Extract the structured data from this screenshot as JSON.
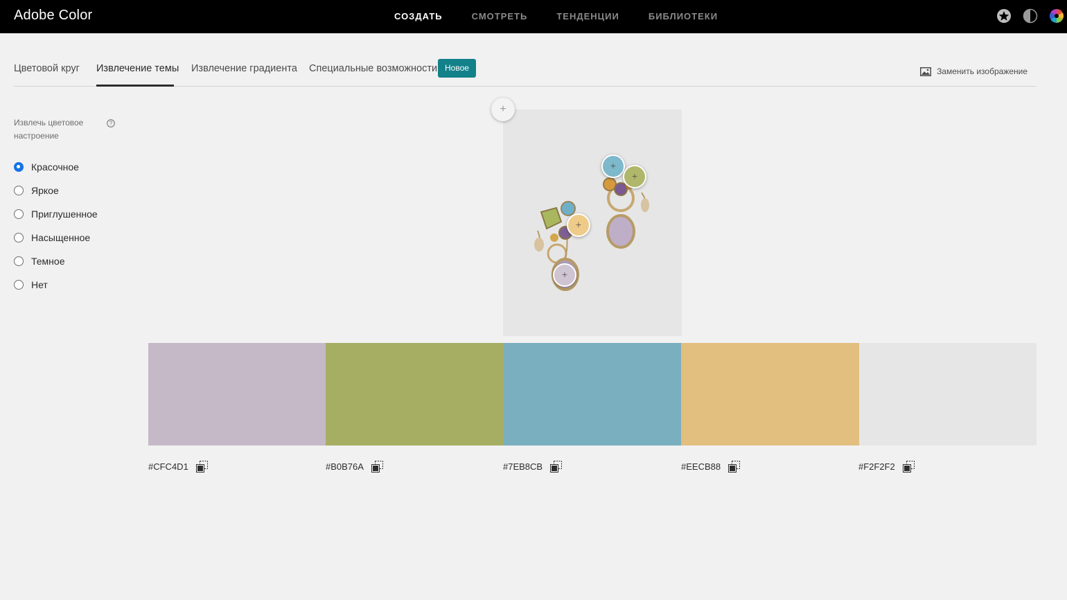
{
  "topbar": {
    "brand": "Adobe Color",
    "nav": [
      "СОЗДАТЬ",
      "СМОТРЕТЬ",
      "ТЕНДЕНЦИИ",
      "БИБЛИОТЕКИ"
    ],
    "active_nav": "СОЗДАТЬ",
    "icons": [
      "star-icon",
      "contrast-icon",
      "color-wheel-icon"
    ]
  },
  "tabs": {
    "items": [
      "Цветовой круг",
      "Извлечение темы",
      "Извлечение градиента",
      "Специальные возможности"
    ],
    "active": "Извлечение темы",
    "badge": "Новое",
    "replace_image": "Заменить изображение"
  },
  "mood": {
    "label": "Извлечь цветовое настроение",
    "options": [
      "Красочное",
      "Яркое",
      "Приглушенное",
      "Насыщенное",
      "Темное",
      "Нет"
    ],
    "selected": "Красочное"
  },
  "image": {
    "add_handle": "+",
    "picker_symbol": "+",
    "picker_colors": [
      "#7EB8CB",
      "#B0B76A",
      "#EECB88",
      "#CFC4D1"
    ]
  },
  "swatches": [
    {
      "hex": "#CFC4D1",
      "color": "#c5b9c7"
    },
    {
      "hex": "#B0B76A",
      "color": "#a6ae63"
    },
    {
      "hex": "#7EB8CB",
      "color": "#7aafc0"
    },
    {
      "hex": "#EECB88",
      "color": "#e2be7f"
    },
    {
      "hex": "#F2F2F2",
      "color": "#e6e6e6"
    }
  ]
}
